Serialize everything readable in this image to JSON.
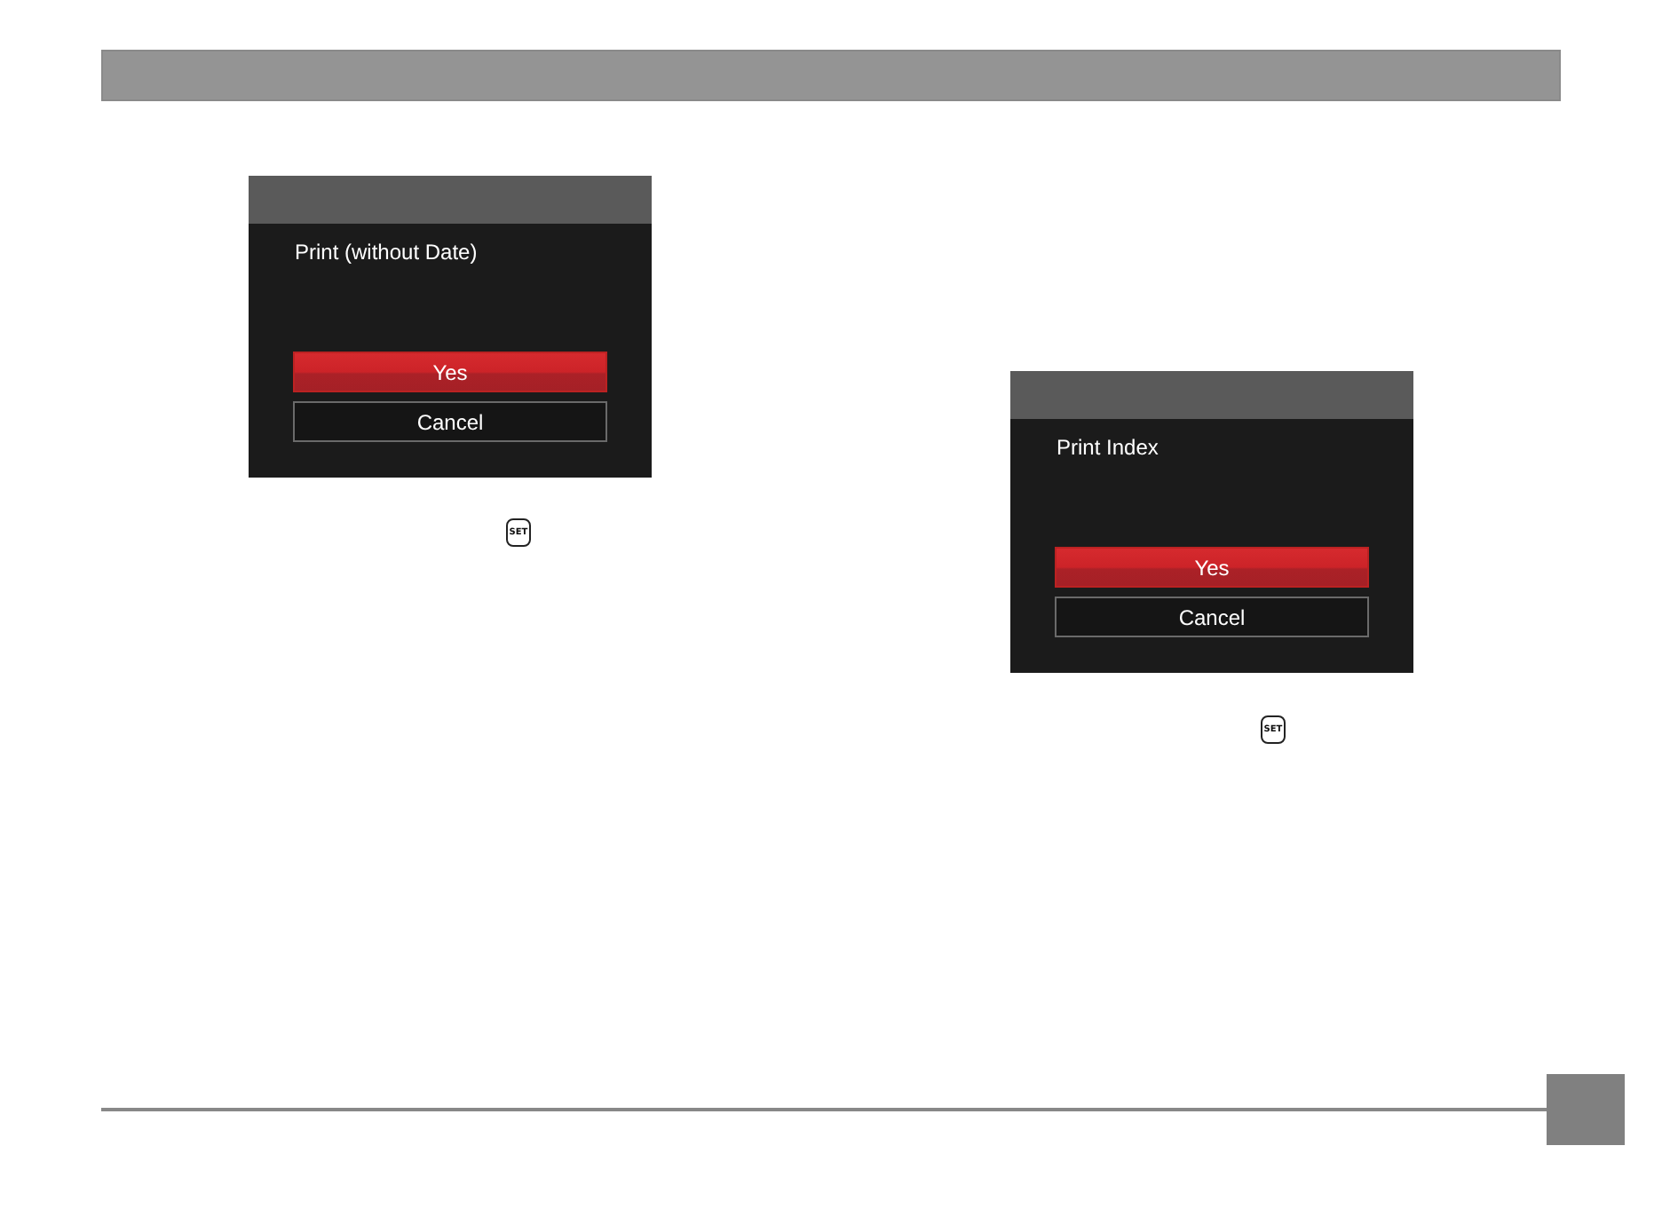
{
  "dialogs": [
    {
      "message": "Print (without Date)",
      "buttons": [
        {
          "label": "Yes",
          "selected": true
        },
        {
          "label": "Cancel",
          "selected": false
        }
      ],
      "key_label": "SET"
    },
    {
      "message": "Print Index",
      "buttons": [
        {
          "label": "Yes",
          "selected": true
        },
        {
          "label": "Cancel",
          "selected": false
        }
      ],
      "key_label": "SET"
    }
  ]
}
